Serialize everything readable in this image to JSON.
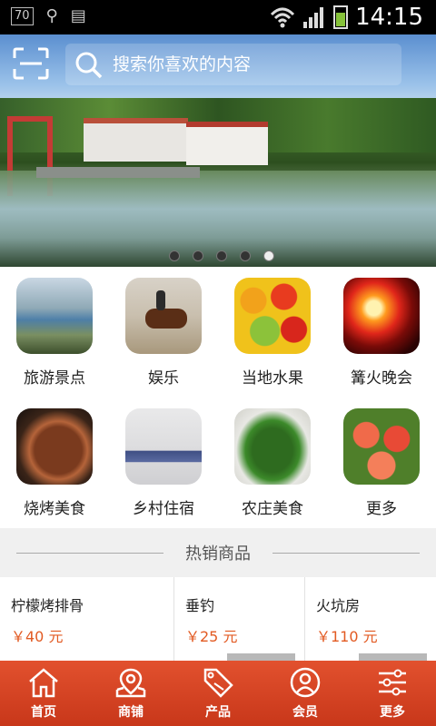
{
  "status_bar": {
    "badge": "70",
    "time": "14:15"
  },
  "search": {
    "placeholder": "搜索你喜欢的内容"
  },
  "banner": {
    "dots_total": 5,
    "active_dot": 5
  },
  "categories": [
    {
      "label": "旅游景点"
    },
    {
      "label": "娱乐"
    },
    {
      "label": "当地水果"
    },
    {
      "label": "篝火晚会"
    },
    {
      "label": "烧烤美食"
    },
    {
      "label": "乡村住宿"
    },
    {
      "label": "农庄美食"
    },
    {
      "label": "更多"
    }
  ],
  "hot_section": {
    "title": "热销商品"
  },
  "products": [
    {
      "name": "柠檬烤排骨",
      "price": "￥40 元"
    },
    {
      "name": "垂钓",
      "price": "￥25 元"
    },
    {
      "name": "火坑房",
      "price": "￥110 元"
    }
  ],
  "tabbar": [
    {
      "label": "首页",
      "icon": "home-icon"
    },
    {
      "label": "商铺",
      "icon": "map-pin-icon"
    },
    {
      "label": "产品",
      "icon": "sale-tag-icon"
    },
    {
      "label": "会员",
      "icon": "user-icon"
    },
    {
      "label": "更多",
      "icon": "sliders-icon"
    }
  ],
  "colors": {
    "accent": "#d9431f",
    "price": "#e25a22"
  }
}
